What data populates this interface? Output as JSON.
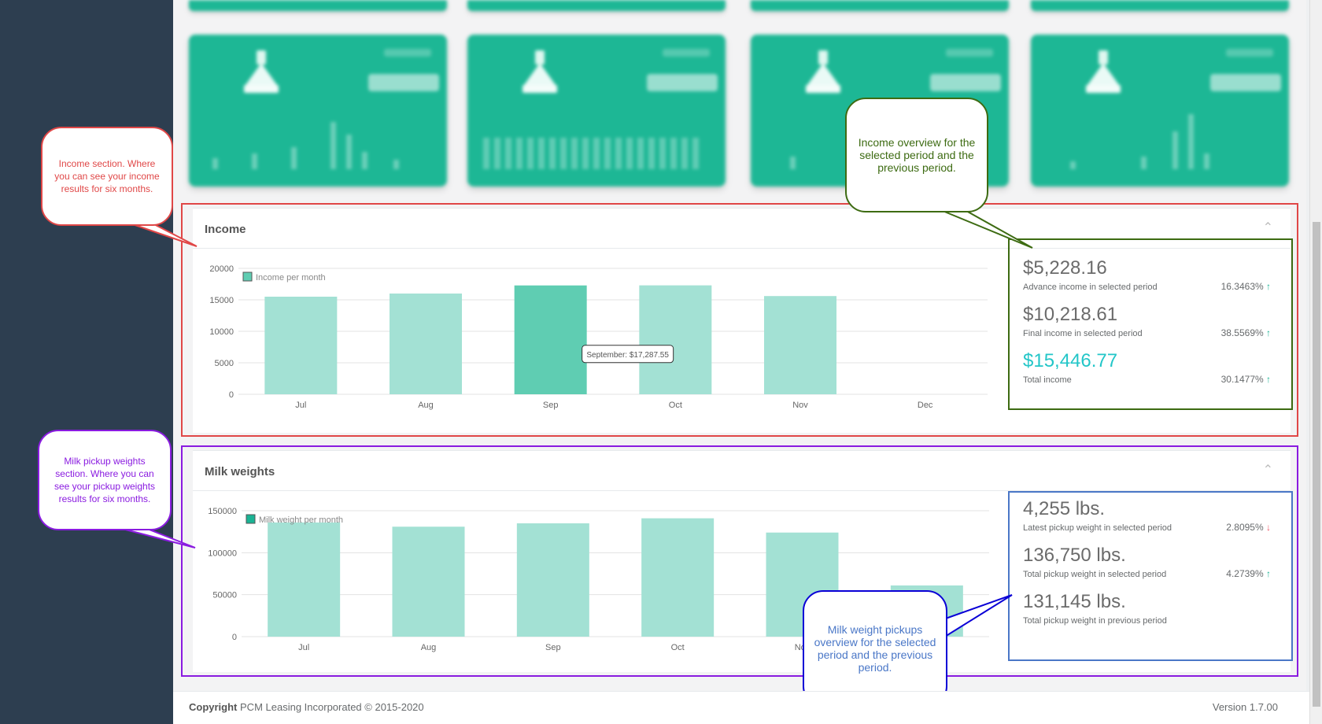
{
  "income": {
    "title": "Income",
    "collapse_icon": "chevron-up-icon",
    "legend": "Income per month",
    "tooltip": "September: $17,287.55",
    "stats": [
      {
        "value": "$5,228.16",
        "label": "Advance income in selected period",
        "pct": "16.3463%",
        "trend": "up"
      },
      {
        "value": "$10,218.61",
        "label": "Final income in selected period",
        "pct": "38.5569%",
        "trend": "up"
      },
      {
        "value": "$15,446.77",
        "label": "Total income",
        "pct": "30.1477%",
        "trend": "up",
        "accent": "#23c6c8"
      }
    ]
  },
  "milk": {
    "title": "Milk weights",
    "collapse_icon": "chevron-up-icon",
    "legend": "Milk weight per month",
    "stats": [
      {
        "value": "4,255 lbs.",
        "label": "Latest pickup weight in selected period",
        "pct": "2.8095%",
        "trend": "down"
      },
      {
        "value": "136,750 lbs.",
        "label": "Total pickup weight in selected period",
        "pct": "4.2739%",
        "trend": "up"
      },
      {
        "value": "131,145 lbs.",
        "label": "Total pickup weight in previous period",
        "pct": "",
        "trend": ""
      }
    ]
  },
  "chart_data": [
    {
      "type": "bar",
      "categories": [
        "Jul",
        "Aug",
        "Sep",
        "Oct",
        "Nov",
        "Dec"
      ],
      "series": [
        {
          "name": "Income per month",
          "values": [
            15500,
            16000,
            17287.55,
            17300,
            15600,
            0
          ]
        }
      ],
      "yticks": [
        0,
        5000,
        10000,
        15000,
        20000
      ],
      "ylim": [
        0,
        20000
      ],
      "highlighted": "Sep",
      "grid": true,
      "legend_position": "top-left",
      "color": "#a3e1d4",
      "highlight_color": "#5fcdb2"
    },
    {
      "type": "bar",
      "categories": [
        "Jul",
        "Aug",
        "Sep",
        "Oct",
        "Nov",
        "Dec"
      ],
      "series": [
        {
          "name": "Milk weight per month",
          "values": [
            136000,
            131000,
            135000,
            141000,
            124000,
            61000
          ]
        }
      ],
      "yticks": [
        0,
        50000,
        100000,
        150000
      ],
      "ylim": [
        0,
        150000
      ],
      "grid": true,
      "legend_position": "top-left",
      "color": "#a3e1d4"
    }
  ],
  "callouts": {
    "income_section": "Income section. Where you can see your income results for six months.",
    "income_overview": "Income overview for the selected period and the previous period.",
    "milk_section": "Milk pickup weights section. Where you can see your pickup weights results for six months.",
    "milk_overview": "Milk weight pickups overview for the selected period and the previous period."
  },
  "colors": {
    "income_section_border": "#e04747",
    "income_overview_border": "#3d6b12",
    "milk_section_border": "#8a1be0",
    "milk_overview_border": "#4a77c7",
    "milk_callout_border": "#0a00d6",
    "tile_green": "#1db795"
  },
  "footer": {
    "copyright_label": "Copyright",
    "copyright_text": "PCM Leasing Incorporated © 2015-2020",
    "version": "Version 1.7.00"
  }
}
